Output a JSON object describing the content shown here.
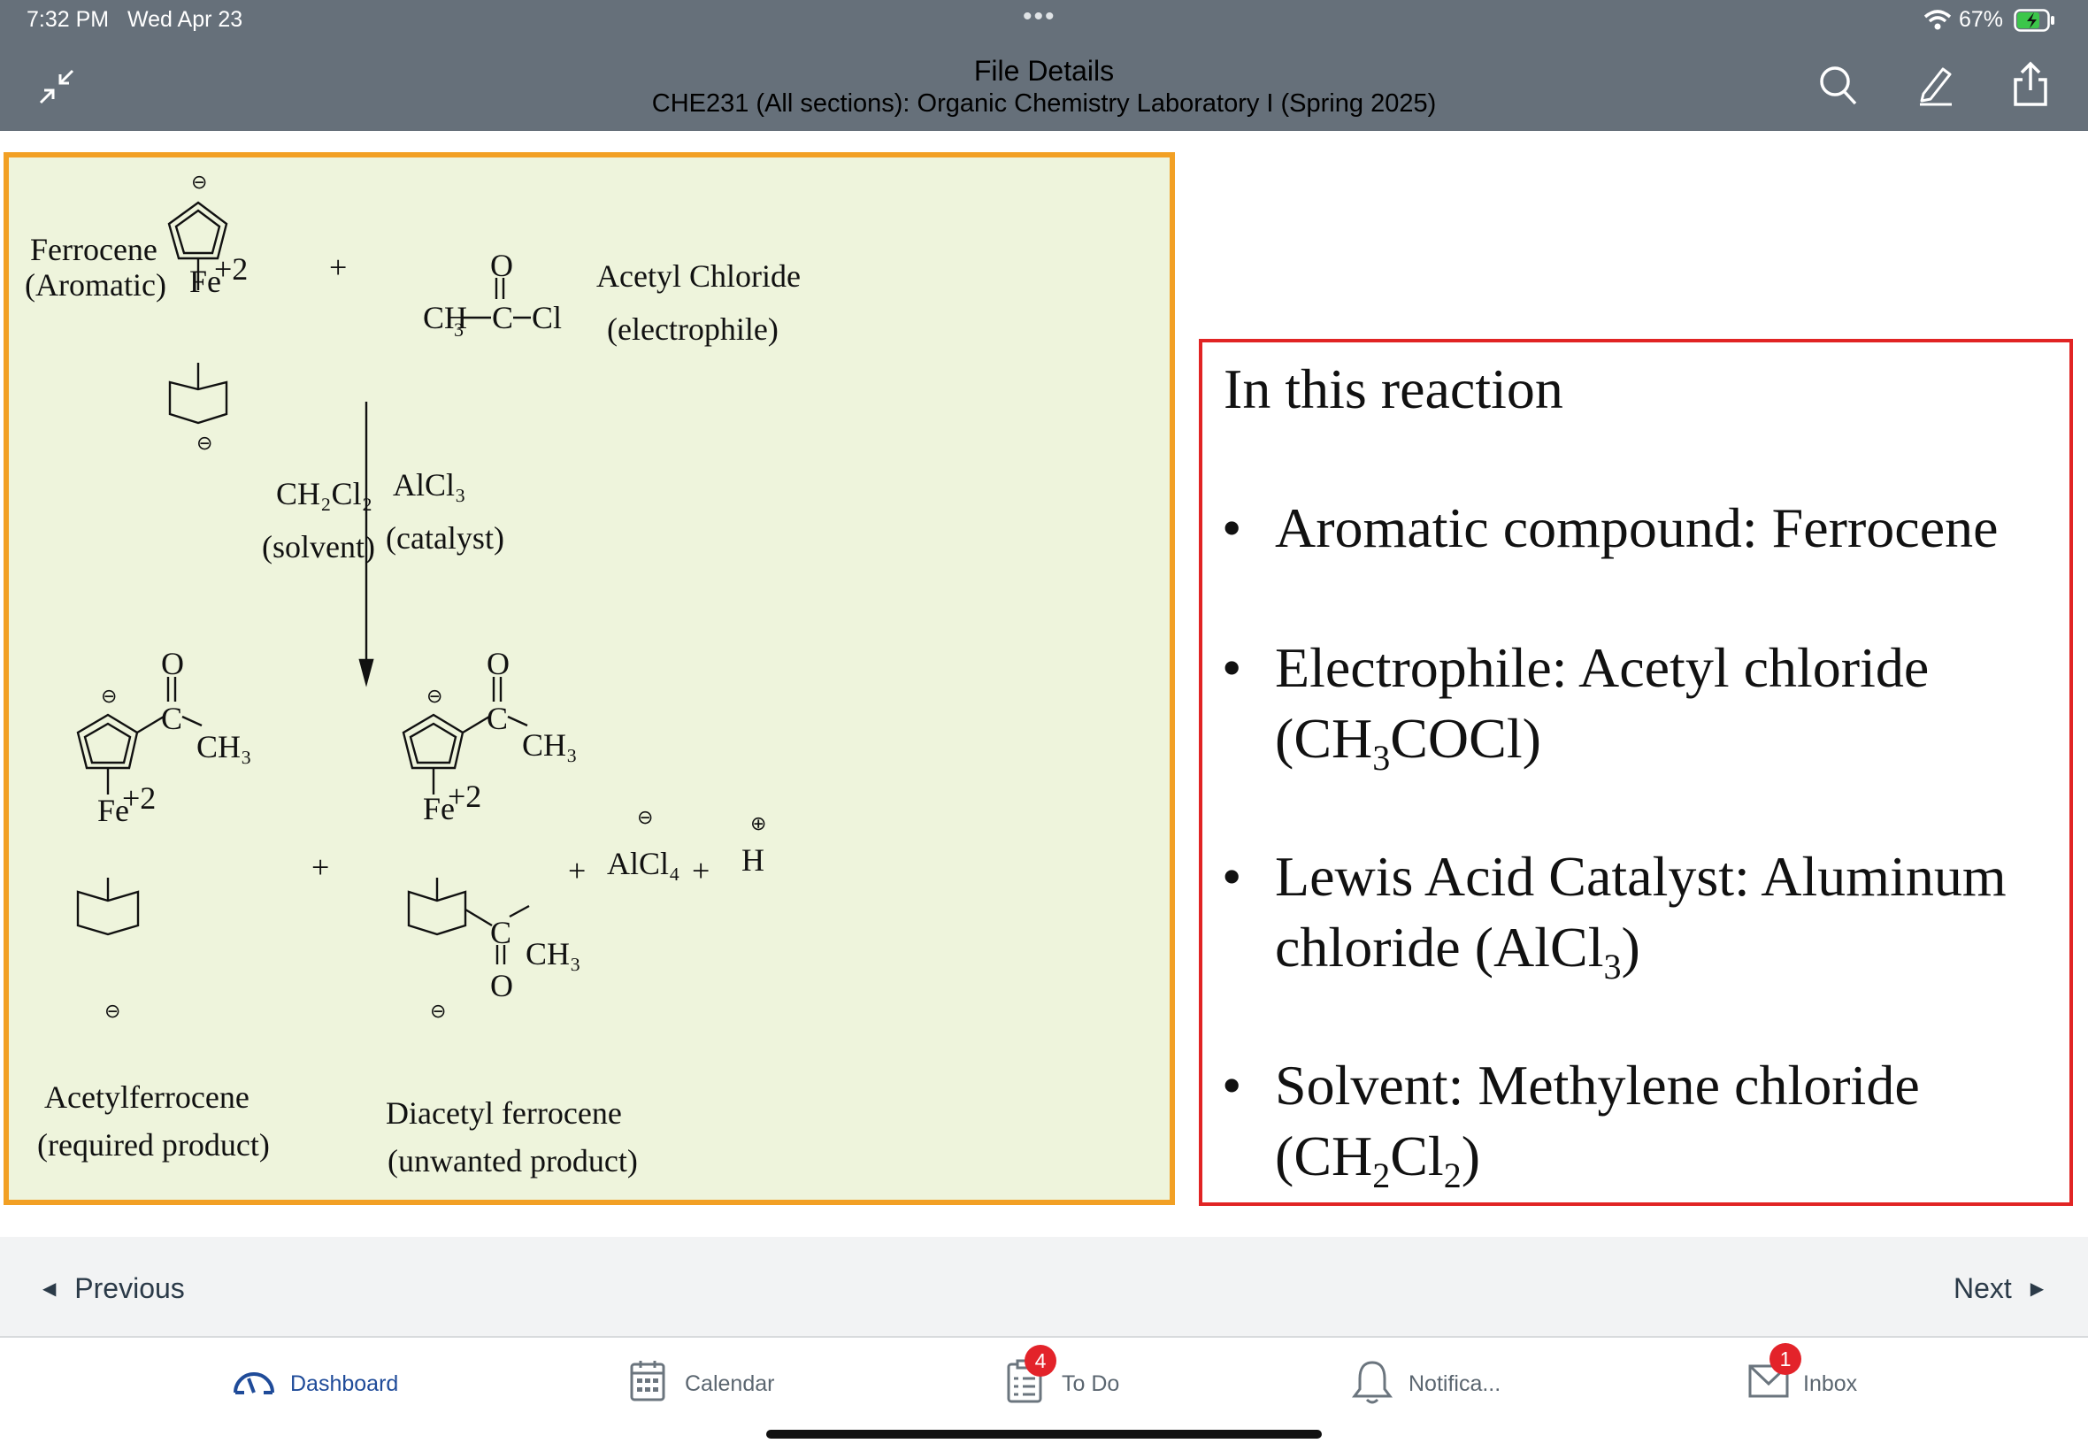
{
  "status_bar": {
    "time": "7:32 PM",
    "date": "Wed Apr 23",
    "battery": "67%",
    "dots": "•••"
  },
  "header": {
    "title": "File Details",
    "subtitle": "CHE231 (All sections): Organic Chemistry Laboratory I (Spring 2025)"
  },
  "chem": {
    "ferrocene": "Ferrocene",
    "aromatic": "(Aromatic)",
    "fe": "Fe",
    "charge": "+2",
    "minus": "⊖",
    "plus_sign": "+",
    "plus_circle": "⊕",
    "acyl_left": "CH",
    "acyl_sub": "3",
    "acyl_c": "C",
    "acyl_cl": "Cl",
    "acyl_o": "O",
    "acetyl_chloride": "Acetyl Chloride",
    "electrophile": "(electrophile)",
    "solvent_formula": "CH₂Cl₂",
    "solvent": "(solvent)",
    "catalyst_formula": "AlCl₃",
    "catalyst": "(catalyst)",
    "ch3": "CH₃",
    "c": "C",
    "o": "O",
    "alcl4": "AlCl₄",
    "h": "H",
    "acetylferrocene": "Acetylferrocene",
    "required": "(required product)",
    "diacetylferrocene": "Diacetyl ferrocene",
    "unwanted": "(unwanted product)"
  },
  "info": {
    "title": "In this reaction",
    "bullets": [
      {
        "l1": "Aromatic compound: Ferrocene"
      },
      {
        "l1": "Electrophile: Acetyl chloride",
        "l2a": "(CH",
        "l2s1": "3",
        "l2b": "COCl)"
      },
      {
        "l1": "Lewis Acid Catalyst: Aluminum",
        "l2a": "chloride (AlCl",
        "l2s1": "3",
        "l2b": ")"
      },
      {
        "l1": "Solvent: Methylene chloride",
        "l2a": "(CH",
        "l2s1": "2",
        "l2b": "Cl",
        "l2s2": "2",
        "l2c": ")"
      }
    ],
    "bullet_char": "•"
  },
  "nav": {
    "previous": "Previous",
    "next": "Next"
  },
  "tabs": [
    {
      "label": "Dashboard"
    },
    {
      "label": "Calendar"
    },
    {
      "label": "To Do",
      "badge": "4"
    },
    {
      "label": "Notifica..."
    },
    {
      "label": "Inbox",
      "badge": "1"
    }
  ],
  "colors": {
    "header": "#66707a",
    "accent": "#1f4b99",
    "chem_bg": "#eef4dc",
    "chem_border": "#f2a024",
    "info_border": "#e12424",
    "badge": "#e3232a"
  }
}
